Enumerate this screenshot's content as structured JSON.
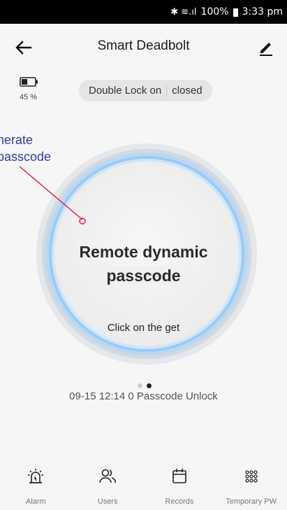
{
  "status_bar": {
    "icons_text": "✱ ≋.ıl",
    "battery": "100%",
    "time": "3:33 pm"
  },
  "header": {
    "title": "Smart Deadbolt"
  },
  "device": {
    "battery_percent": "45 %",
    "battery_level": 0.45,
    "lock_mode": "Double Lock on",
    "door_state": "closed"
  },
  "annotation": {
    "line1": "nerate",
    "line2": "passcode"
  },
  "dial": {
    "title_line1": "Remote dynamic",
    "title_line2": "passcode",
    "action": "Click on the get"
  },
  "pager": {
    "count": 2,
    "active": 1
  },
  "record": {
    "text": "09-15 12:14  0 Passcode Unlock"
  },
  "nav": {
    "items": [
      {
        "label": "Alarm",
        "icon": "alarm-icon"
      },
      {
        "label": "Users",
        "icon": "users-icon"
      },
      {
        "label": "Records",
        "icon": "calendar-icon"
      },
      {
        "label": "Temporary PW",
        "icon": "keypad-icon"
      }
    ]
  },
  "colors": {
    "ring_blue": "#8ec1f2",
    "ring_gray": "#dde1e6",
    "annotation": "#3a3aa0",
    "annotation_line": "#e0193a"
  }
}
